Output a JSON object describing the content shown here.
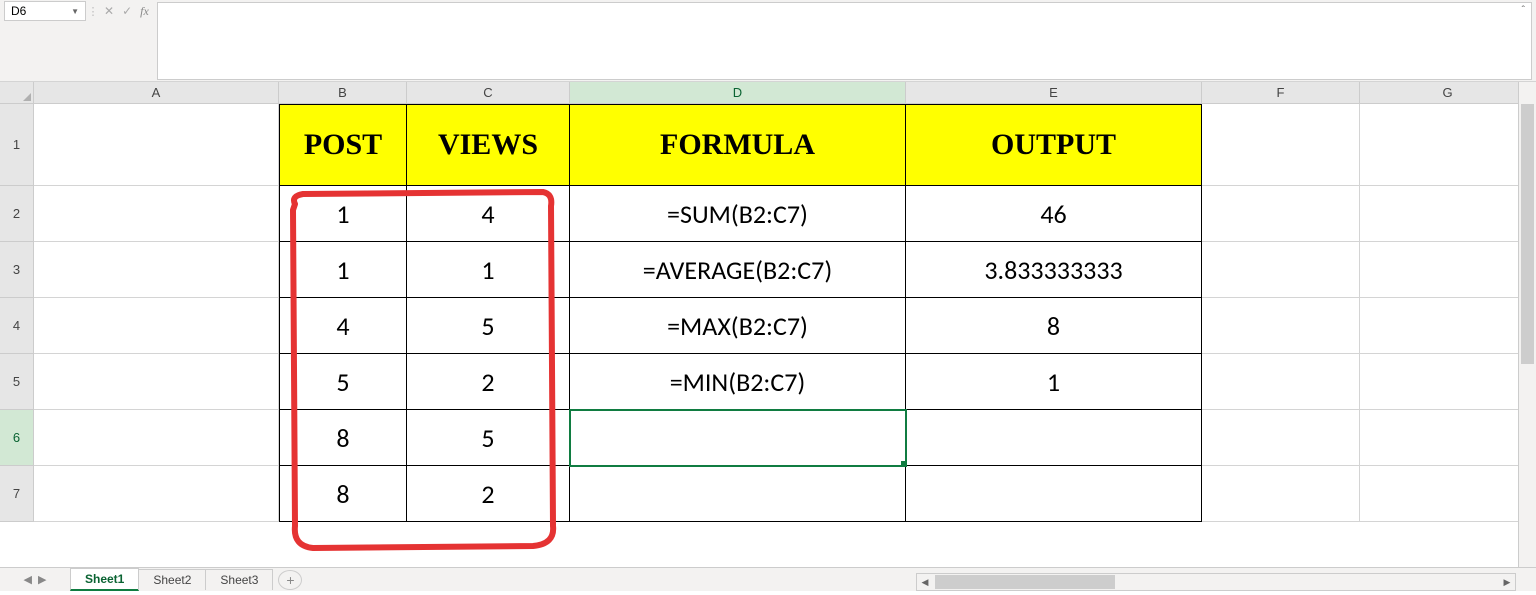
{
  "nameBox": "D6",
  "formulaBar": "",
  "columns": [
    "A",
    "B",
    "C",
    "D",
    "E",
    "F",
    "G"
  ],
  "activeColumn": "D",
  "activeRow": 6,
  "headers": {
    "B1": "POST",
    "C1": "VIEWS",
    "D1": "FORMULA",
    "E1": "OUTPUT"
  },
  "data": {
    "B2": "1",
    "C2": "4",
    "D2": "=SUM(B2:C7)",
    "E2": "46",
    "B3": "1",
    "C3": "1",
    "D3": "=AVERAGE(B2:C7)",
    "E3": "3.833333333",
    "B4": "4",
    "C4": "5",
    "D4": "=MAX(B2:C7)",
    "E4": "8",
    "B5": "5",
    "C5": "2",
    "D5": "=MIN(B2:C7)",
    "E5": "1",
    "B6": "8",
    "C6": "5",
    "B7": "8",
    "C7": "2"
  },
  "chart_data": {
    "type": "table",
    "title": "",
    "columns": [
      "POST",
      "VIEWS",
      "FORMULA",
      "OUTPUT"
    ],
    "rows": [
      [
        "1",
        "4",
        "=SUM(B2:C7)",
        "46"
      ],
      [
        "1",
        "1",
        "=AVERAGE(B2:C7)",
        "3.833333333"
      ],
      [
        "4",
        "5",
        "=MAX(B2:C7)",
        "8"
      ],
      [
        "5",
        "2",
        "=MIN(B2:C7)",
        "1"
      ],
      [
        "8",
        "5",
        "",
        ""
      ],
      [
        "8",
        "2",
        "",
        ""
      ]
    ]
  },
  "sheets": [
    "Sheet1",
    "Sheet2",
    "Sheet3"
  ],
  "activeSheet": "Sheet1"
}
